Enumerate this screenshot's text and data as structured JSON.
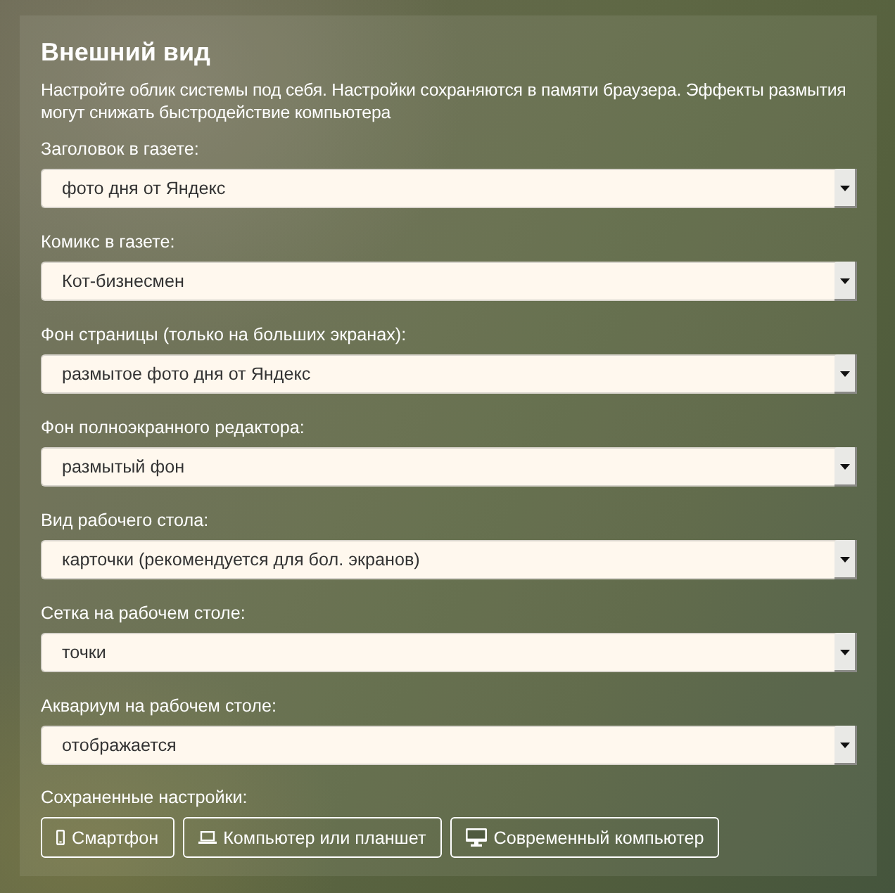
{
  "panel": {
    "title": "Внешний вид",
    "description": "Настройте облик системы под себя. Настройки сохраняются в памяти браузера. Эффекты размытия могут снижать быстродействие компьютера"
  },
  "settings": [
    {
      "label": "Заголовок в газете:",
      "value": "фото дня от Яндекс"
    },
    {
      "label": "Комикс в газете:",
      "value": "Кот-бизнесмен"
    },
    {
      "label": "Фон страницы (только на больших экранах):",
      "value": "размытое фото дня от Яндекс"
    },
    {
      "label": "Фон полноэкранного редактора:",
      "value": "размытый фон"
    },
    {
      "label": "Вид рабочего стола:",
      "value": "карточки (рекомендуется для бол. экранов)"
    },
    {
      "label": "Сетка на рабочем столе:",
      "value": "точки"
    },
    {
      "label": "Аквариум на рабочем столе:",
      "value": "отображается"
    }
  ],
  "saved_presets": {
    "label": "Сохраненные настройки:",
    "buttons": [
      {
        "kind": "phone",
        "label": "Смартфон"
      },
      {
        "kind": "laptop",
        "label": "Компьютер или планшет"
      },
      {
        "kind": "desktop",
        "label": "Современный компьютер"
      }
    ]
  }
}
